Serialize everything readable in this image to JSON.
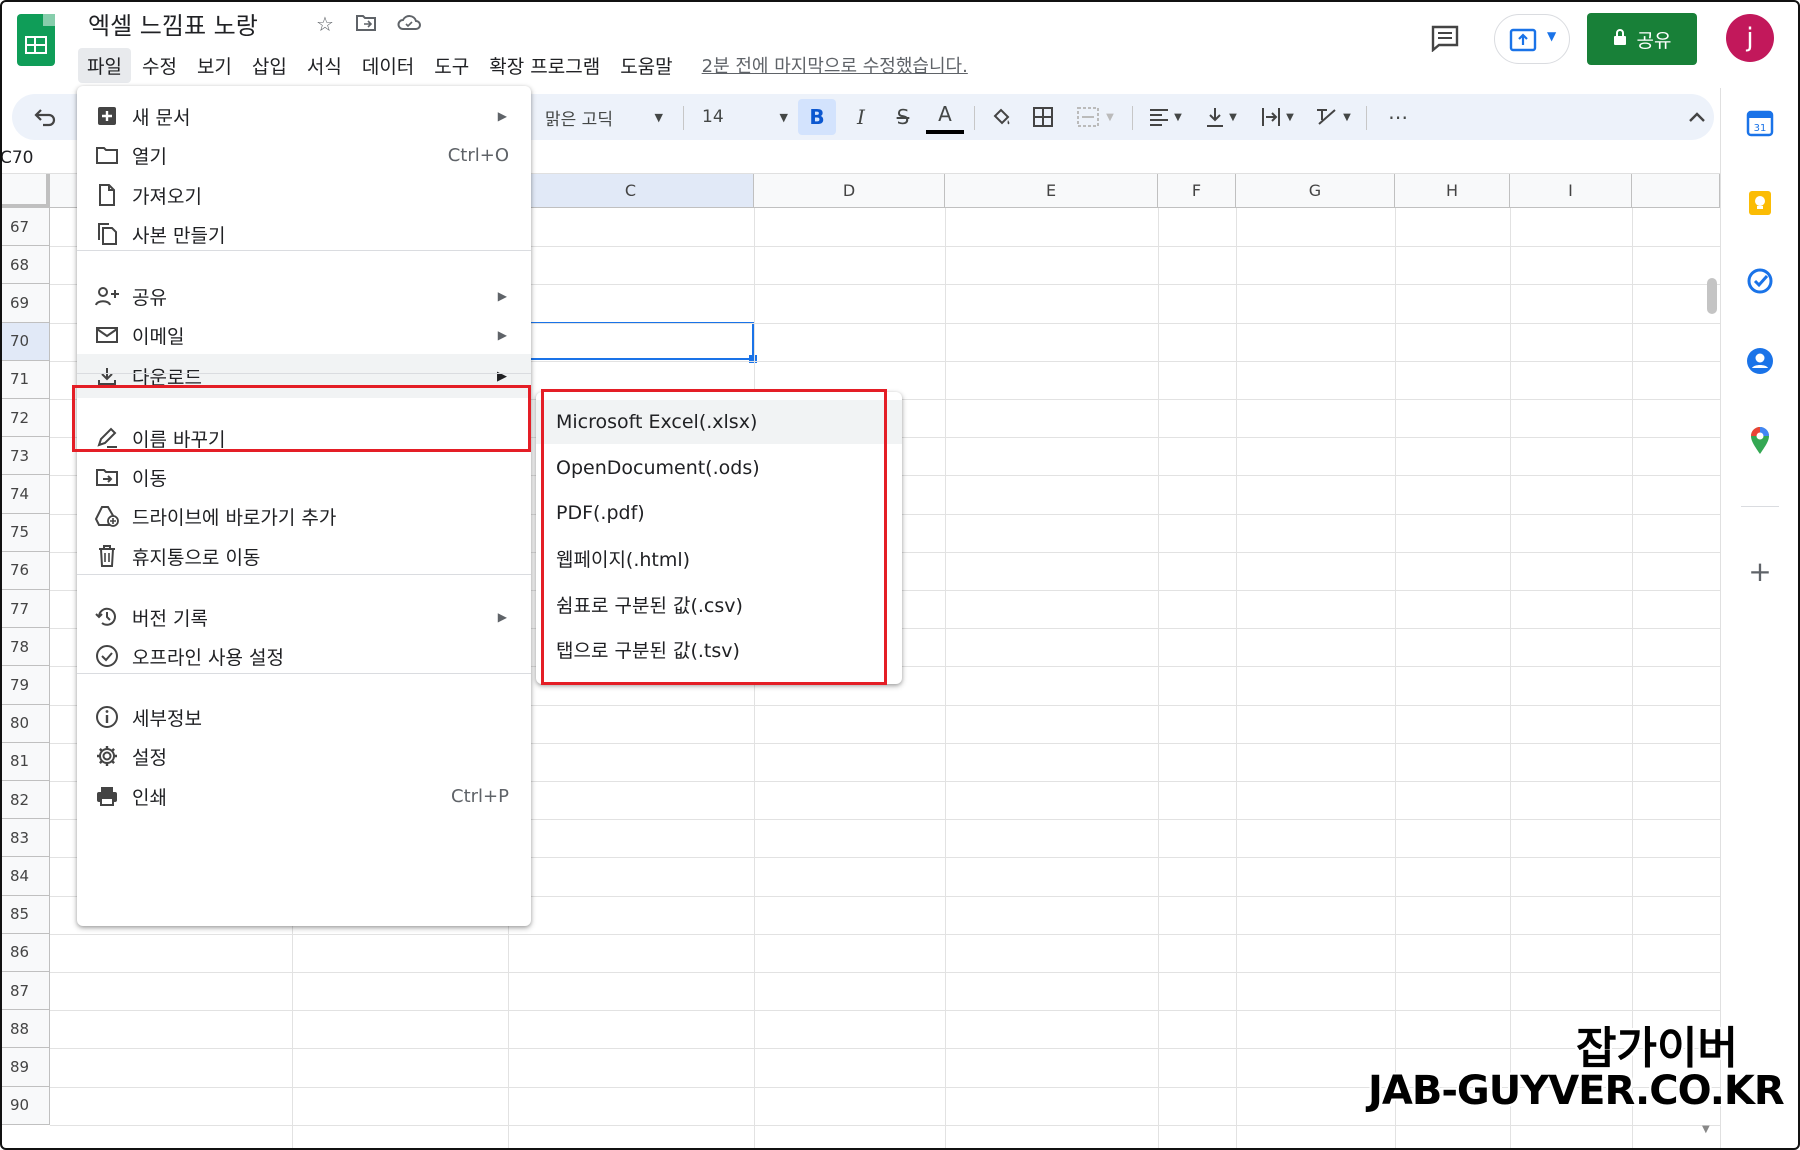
{
  "header": {
    "doc_title": "엑셀 느낌표 노랑",
    "menus": [
      "파일",
      "수정",
      "보기",
      "삽입",
      "서식",
      "데이터",
      "도구",
      "확장 프로그램",
      "도움말"
    ],
    "last_edit": "2분 전에 마지막으로 수정했습니다.",
    "share_label": "공유",
    "avatar_letter": "j"
  },
  "toolbar": {
    "font_name": "맑은 고딕",
    "font_size": "14",
    "bold": "B",
    "italic": "I",
    "strike": "S",
    "text_color": "A",
    "more": "⋯"
  },
  "formula_bar": {
    "cell_ref": "C70"
  },
  "grid": {
    "columns": [
      "C",
      "D",
      "E",
      "F",
      "G",
      "H",
      "I"
    ],
    "rows": [
      "67",
      "68",
      "69",
      "70",
      "71",
      "72",
      "73",
      "74",
      "75",
      "76",
      "77",
      "78",
      "79",
      "80",
      "81",
      "82",
      "83",
      "84",
      "85",
      "86",
      "87",
      "88",
      "89",
      "90"
    ],
    "selected_row": "70",
    "selected_col": "C"
  },
  "file_menu": {
    "items": [
      {
        "label": "새 문서",
        "icon": "new-doc-icon",
        "shortcut": "",
        "submenu": true
      },
      {
        "label": "열기",
        "icon": "folder-icon",
        "shortcut": "Ctrl+O",
        "submenu": false
      },
      {
        "label": "가져오기",
        "icon": "import-file-icon",
        "shortcut": "",
        "submenu": false
      },
      {
        "label": "사본 만들기",
        "icon": "copy-icon",
        "shortcut": "",
        "submenu": false
      },
      {
        "label": "공유",
        "icon": "person-add-icon",
        "shortcut": "",
        "submenu": true
      },
      {
        "label": "이메일",
        "icon": "email-icon",
        "shortcut": "",
        "submenu": true
      },
      {
        "label": "다운로드",
        "icon": "download-icon",
        "shortcut": "",
        "submenu": true
      },
      {
        "label": "이름 바꾸기",
        "icon": "rename-icon",
        "shortcut": "",
        "submenu": false
      },
      {
        "label": "이동",
        "icon": "move-folder-icon",
        "shortcut": "",
        "submenu": false
      },
      {
        "label": "드라이브에 바로가기 추가",
        "icon": "drive-shortcut-icon",
        "shortcut": "",
        "submenu": false
      },
      {
        "label": "휴지통으로 이동",
        "icon": "trash-icon",
        "shortcut": "",
        "submenu": false
      },
      {
        "label": "버전 기록",
        "icon": "history-icon",
        "shortcut": "",
        "submenu": true
      },
      {
        "label": "오프라인 사용 설정",
        "icon": "offline-icon",
        "shortcut": "",
        "submenu": false
      },
      {
        "label": "세부정보",
        "icon": "info-icon",
        "shortcut": "",
        "submenu": false
      },
      {
        "label": "설정",
        "icon": "gear-icon",
        "shortcut": "",
        "submenu": false
      },
      {
        "label": "인쇄",
        "icon": "printer-icon",
        "shortcut": "Ctrl+P",
        "submenu": false
      }
    ]
  },
  "download_submenu": {
    "items": [
      "Microsoft Excel(.xlsx)",
      "OpenDocument(.ods)",
      "PDF(.pdf)",
      "웹페이지(.html)",
      "쉼표로 구분된 값(.csv)",
      "탭으로 구분된 값(.tsv)"
    ]
  },
  "watermark": {
    "line1": "잡가이버",
    "line2": "JAB-GUYVER.CO.KR"
  },
  "colors": {
    "accent": "#1a73e8",
    "share_green": "#188038",
    "highlight_red": "#e41e26",
    "avatar": "#c2185b"
  }
}
